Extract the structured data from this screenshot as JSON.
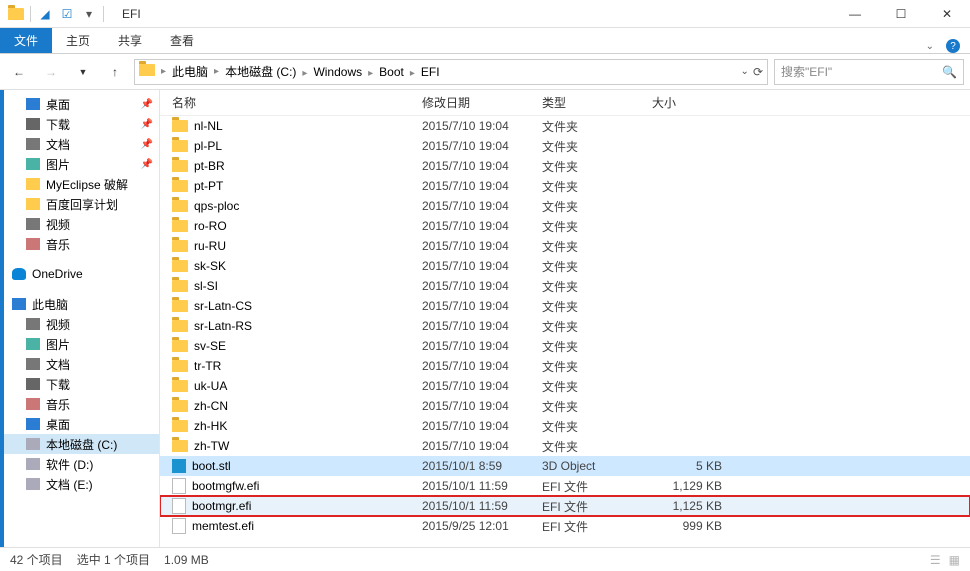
{
  "window": {
    "title": "EFI"
  },
  "ribbon": {
    "file": "文件",
    "home": "主页",
    "share": "共享",
    "view": "查看"
  },
  "breadcrumb": {
    "root": "此电脑",
    "items": [
      "本地磁盘 (C:)",
      "Windows",
      "Boot",
      "EFI"
    ]
  },
  "search": {
    "placeholder": "搜索\"EFI\""
  },
  "sidebar": {
    "quick": [
      {
        "label": "桌面",
        "icon": "ic-desktop",
        "pinned": true
      },
      {
        "label": "下载",
        "icon": "ic-download",
        "pinned": true
      },
      {
        "label": "文档",
        "icon": "ic-doc",
        "pinned": true
      },
      {
        "label": "图片",
        "icon": "ic-img",
        "pinned": true
      },
      {
        "label": "MyEclipse 破解",
        "icon": "ic-folder",
        "pinned": false
      },
      {
        "label": "百度回享计划",
        "icon": "ic-folder",
        "pinned": false
      },
      {
        "label": "视频",
        "icon": "ic-video",
        "pinned": false
      },
      {
        "label": "音乐",
        "icon": "ic-music",
        "pinned": false
      }
    ],
    "onedrive": "OneDrive",
    "this_pc": "此电脑",
    "pc_items": [
      {
        "label": "视频",
        "icon": "ic-video"
      },
      {
        "label": "图片",
        "icon": "ic-img"
      },
      {
        "label": "文档",
        "icon": "ic-doc"
      },
      {
        "label": "下载",
        "icon": "ic-download"
      },
      {
        "label": "音乐",
        "icon": "ic-music"
      },
      {
        "label": "桌面",
        "icon": "ic-desktop"
      },
      {
        "label": "本地磁盘 (C:)",
        "icon": "ic-drive",
        "selected": true
      },
      {
        "label": "软件 (D:)",
        "icon": "ic-drive"
      },
      {
        "label": "文档 (E:)",
        "icon": "ic-drive"
      }
    ]
  },
  "columns": {
    "name": "名称",
    "date": "修改日期",
    "type": "类型",
    "size": "大小"
  },
  "files": [
    {
      "name": "nl-NL",
      "date": "2015/7/10 19:04",
      "type": "文件夹",
      "size": "",
      "kind": "folder"
    },
    {
      "name": "pl-PL",
      "date": "2015/7/10 19:04",
      "type": "文件夹",
      "size": "",
      "kind": "folder"
    },
    {
      "name": "pt-BR",
      "date": "2015/7/10 19:04",
      "type": "文件夹",
      "size": "",
      "kind": "folder"
    },
    {
      "name": "pt-PT",
      "date": "2015/7/10 19:04",
      "type": "文件夹",
      "size": "",
      "kind": "folder"
    },
    {
      "name": "qps-ploc",
      "date": "2015/7/10 19:04",
      "type": "文件夹",
      "size": "",
      "kind": "folder"
    },
    {
      "name": "ro-RO",
      "date": "2015/7/10 19:04",
      "type": "文件夹",
      "size": "",
      "kind": "folder"
    },
    {
      "name": "ru-RU",
      "date": "2015/7/10 19:04",
      "type": "文件夹",
      "size": "",
      "kind": "folder"
    },
    {
      "name": "sk-SK",
      "date": "2015/7/10 19:04",
      "type": "文件夹",
      "size": "",
      "kind": "folder"
    },
    {
      "name": "sl-SI",
      "date": "2015/7/10 19:04",
      "type": "文件夹",
      "size": "",
      "kind": "folder"
    },
    {
      "name": "sr-Latn-CS",
      "date": "2015/7/10 19:04",
      "type": "文件夹",
      "size": "",
      "kind": "folder"
    },
    {
      "name": "sr-Latn-RS",
      "date": "2015/7/10 19:04",
      "type": "文件夹",
      "size": "",
      "kind": "folder"
    },
    {
      "name": "sv-SE",
      "date": "2015/7/10 19:04",
      "type": "文件夹",
      "size": "",
      "kind": "folder"
    },
    {
      "name": "tr-TR",
      "date": "2015/7/10 19:04",
      "type": "文件夹",
      "size": "",
      "kind": "folder"
    },
    {
      "name": "uk-UA",
      "date": "2015/7/10 19:04",
      "type": "文件夹",
      "size": "",
      "kind": "folder"
    },
    {
      "name": "zh-CN",
      "date": "2015/7/10 19:04",
      "type": "文件夹",
      "size": "",
      "kind": "folder"
    },
    {
      "name": "zh-HK",
      "date": "2015/7/10 19:04",
      "type": "文件夹",
      "size": "",
      "kind": "folder"
    },
    {
      "name": "zh-TW",
      "date": "2015/7/10 19:04",
      "type": "文件夹",
      "size": "",
      "kind": "folder"
    },
    {
      "name": "boot.stl",
      "date": "2015/10/1 8:59",
      "type": "3D Object",
      "size": "5 KB",
      "kind": "3d",
      "selected": true
    },
    {
      "name": "bootmgfw.efi",
      "date": "2015/10/1 11:59",
      "type": "EFI 文件",
      "size": "1,129 KB",
      "kind": "file"
    },
    {
      "name": "bootmgr.efi",
      "date": "2015/10/1 11:59",
      "type": "EFI 文件",
      "size": "1,125 KB",
      "kind": "file",
      "highlighted": true
    },
    {
      "name": "memtest.efi",
      "date": "2015/9/25 12:01",
      "type": "EFI 文件",
      "size": "999 KB",
      "kind": "file"
    }
  ],
  "status": {
    "count": "42 个项目",
    "selection": "选中 1 个项目",
    "size": "1.09 MB"
  }
}
